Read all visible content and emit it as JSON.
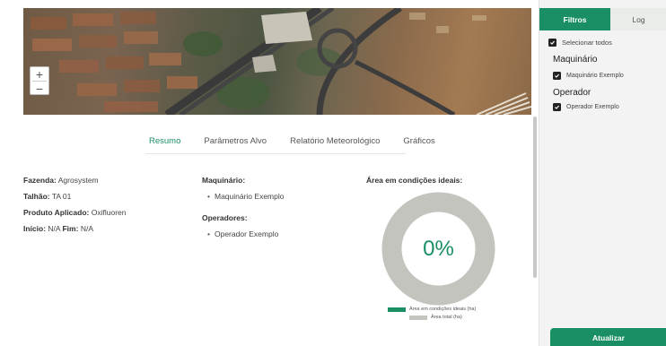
{
  "map": {
    "zoom_in_label": "+",
    "zoom_out_label": "−"
  },
  "tabs": [
    {
      "label": "Resumo",
      "active": true
    },
    {
      "label": "Parâmetros Alvo",
      "active": false
    },
    {
      "label": "Relatório Meteorológico",
      "active": false
    },
    {
      "label": "Gráficos",
      "active": false
    }
  ],
  "summary": {
    "farm_label": "Fazenda:",
    "farm_value": "Agrosystem",
    "plot_label": "Talhão:",
    "plot_value": "TA 01",
    "product_label": "Produto Aplicado:",
    "product_value": "Oxifluoren",
    "start_label": "Início:",
    "start_value": "N/A",
    "end_label": "Fim:",
    "end_value": "N/A"
  },
  "machinery": {
    "title": "Maquinário:",
    "items": [
      "Maquinário Exemplo"
    ]
  },
  "operators": {
    "title": "Operadores:",
    "items": [
      "Operador Exemplo"
    ]
  },
  "area_chart": {
    "title": "Área em condições ideais:",
    "percent_label": "0%",
    "ideal_fraction": 0,
    "legend": [
      {
        "label": "Área em condições ideais (ha)",
        "color": "#1a8f63"
      },
      {
        "label": "Área total (ha)",
        "color": "#c4c4bf"
      }
    ]
  },
  "sidebar": {
    "tabs": {
      "filters": "Filtros",
      "log": "Log"
    },
    "select_all": "Selecionar todos",
    "groups": [
      {
        "title": "Maquinário",
        "items": [
          "Maquinário Exemplo"
        ]
      },
      {
        "title": "Operador",
        "items": [
          "Operador Exemplo"
        ]
      }
    ],
    "update_button": "Atualizar"
  },
  "colors": {
    "accent": "#1a8f63",
    "donut_gray": "#c4c4bf"
  }
}
